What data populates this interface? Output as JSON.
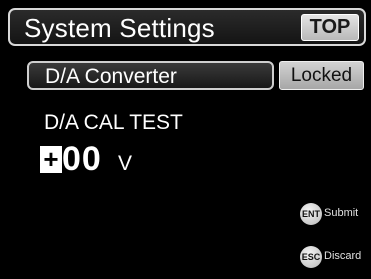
{
  "header": {
    "title": "System Settings",
    "top_button": "TOP"
  },
  "section": {
    "label": "D/A Converter",
    "status": "Locked"
  },
  "test": {
    "title": "D/A CAL TEST",
    "sign": "+",
    "value": "00",
    "unit": "V"
  },
  "keys": {
    "submit": {
      "key": "ENT",
      "label": "Submit"
    },
    "discard": {
      "key": "ESC",
      "label": "Discard"
    }
  },
  "colors": {
    "background": "#000000",
    "text": "#ffffff",
    "button": "#c8c8c8"
  }
}
